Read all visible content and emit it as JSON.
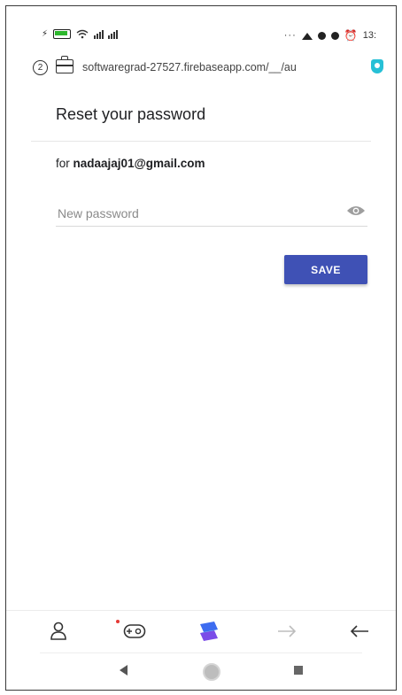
{
  "status_bar": {
    "right_text": "13:"
  },
  "browser": {
    "tab_count": "2",
    "url": "softwaregrad-27527.firebaseapp.com/__/au"
  },
  "page": {
    "title": "Reset your password",
    "for_prefix": "for",
    "email": "nadaajaj01@gmail.com",
    "password_placeholder": "New password",
    "save_label": "SAVE"
  },
  "colors": {
    "accent": "#3f51b5",
    "shield": "#27c0d6"
  },
  "toolbar": {
    "icons": [
      "profile-icon",
      "game-controller-icon",
      "browser-logo-icon",
      "forward-arrow-icon",
      "back-arrow-icon"
    ]
  }
}
